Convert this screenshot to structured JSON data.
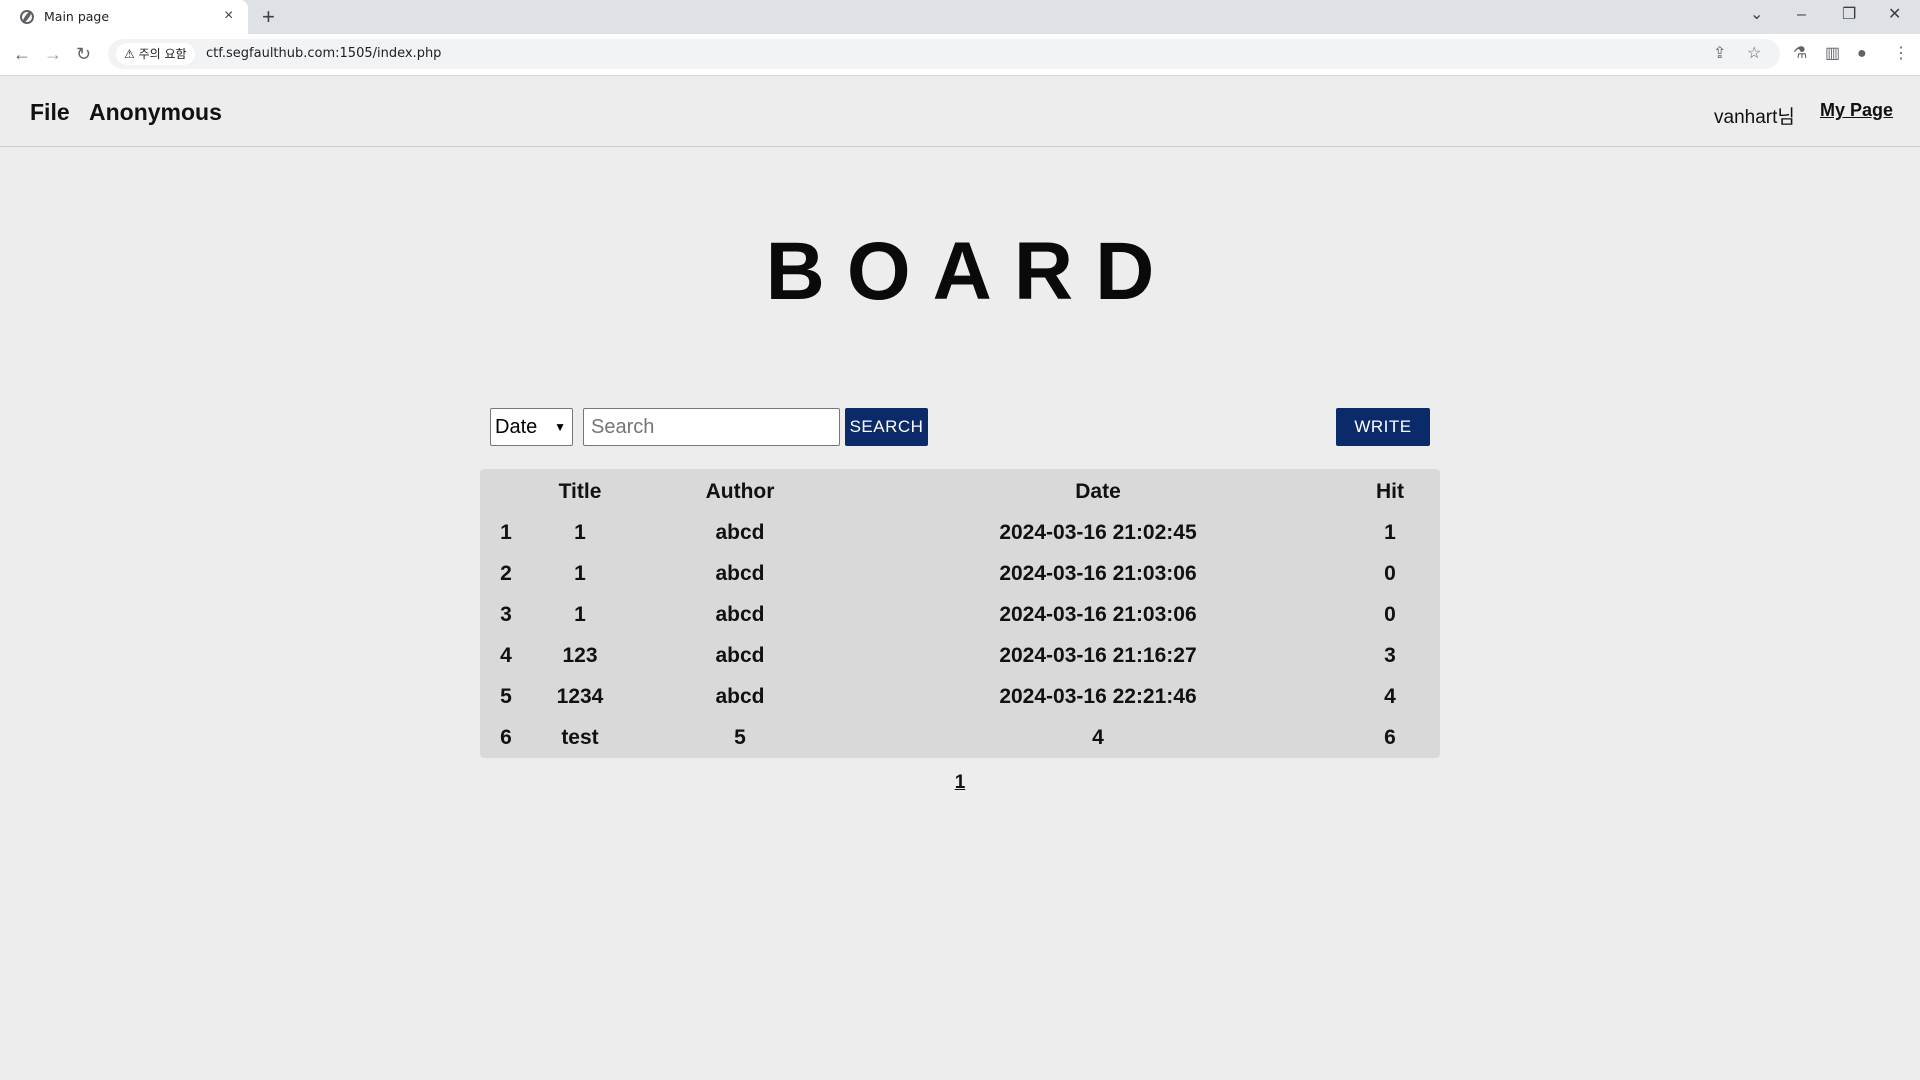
{
  "browser": {
    "tab_title": "Main page",
    "tab_close": "×",
    "new_tab": "+",
    "security_label": "⚠ 주의 요함",
    "url": "ctf.segfaulthub.com:1505/index.php",
    "nav_back": "←",
    "nav_forward": "→",
    "nav_reload": "↻",
    "win_tablist": "⌄",
    "win_minimize": "–",
    "win_restore": "❐",
    "win_close": "✕",
    "share_icon": "⇪",
    "star_icon": "☆",
    "lab_icon": "⚗",
    "panel_icon": "▥",
    "profile_icon": "●",
    "menu_icon": "⋮"
  },
  "header": {
    "nav": [
      "File",
      "Anonymous"
    ],
    "user": "vanhart님",
    "mypage": "My Page"
  },
  "board": {
    "title": "BOARD",
    "search_select_value": "Date",
    "search_placeholder": "Search",
    "search_button": "SEARCH",
    "write_button": "WRITE",
    "columns": [
      "",
      "Title",
      "Author",
      "Date",
      "Hit"
    ],
    "rows": [
      [
        "1",
        "1",
        "abcd",
        "2024-03-16 21:02:45",
        "1"
      ],
      [
        "2",
        "1",
        "abcd",
        "2024-03-16 21:03:06",
        "0"
      ],
      [
        "3",
        "1",
        "abcd",
        "2024-03-16 21:03:06",
        "0"
      ],
      [
        "4",
        "123",
        "abcd",
        "2024-03-16 21:16:27",
        "3"
      ],
      [
        "5",
        "1234",
        "abcd",
        "2024-03-16 22:21:46",
        "4"
      ],
      [
        "6",
        "test",
        "5",
        "4",
        "6"
      ]
    ],
    "pages": [
      "1"
    ]
  }
}
